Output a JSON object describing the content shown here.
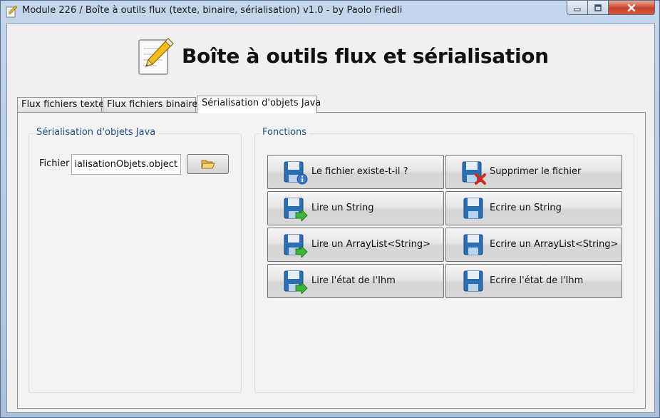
{
  "window": {
    "title": "Module 226 / Boîte à outils flux (texte, binaire, sérialisation) v1.0 - by Paolo Friedli",
    "controls": [
      "minimize-icon",
      "maximize-icon",
      "close-icon"
    ]
  },
  "header": {
    "title": "Boîte à outils flux et sérialisation",
    "icon": "notepad-pencil-icon"
  },
  "tabs": [
    {
      "label": "Flux fichiers texte",
      "active": false
    },
    {
      "label": "Flux fichiers binaires",
      "active": false
    },
    {
      "label": "Sérialisation d'objets Java",
      "active": true
    }
  ],
  "serialization_group": {
    "title": "Sérialisation d'objets Java",
    "file_label": "Fichier",
    "file_value": "SerialisationObjets.object",
    "browse_icon": "folder-open-icon"
  },
  "functions_group": {
    "title": "Fonctions",
    "buttons": [
      {
        "label": "Le fichier existe-t-il ?",
        "icon": "floppy-info-icon"
      },
      {
        "label": "Supprimer le fichier",
        "icon": "floppy-delete-icon"
      },
      {
        "label": "Lire un String",
        "icon": "floppy-read-icon"
      },
      {
        "label": "Ecrire un String",
        "icon": "floppy-write-icon"
      },
      {
        "label": "Lire un ArrayList<String>",
        "icon": "floppy-read-icon"
      },
      {
        "label": "Ecrire un ArrayList<String>",
        "icon": "floppy-write-icon"
      },
      {
        "label": "Lire l'état de l'Ihm",
        "icon": "floppy-read-icon"
      },
      {
        "label": "Ecrire l'état de l'Ihm",
        "icon": "floppy-write-icon"
      }
    ]
  },
  "colors": {
    "group_title": "#1f4e8c",
    "floppy": "#2a6fb4",
    "arrow": "#3fb43a",
    "delete": "#d42a1e"
  }
}
